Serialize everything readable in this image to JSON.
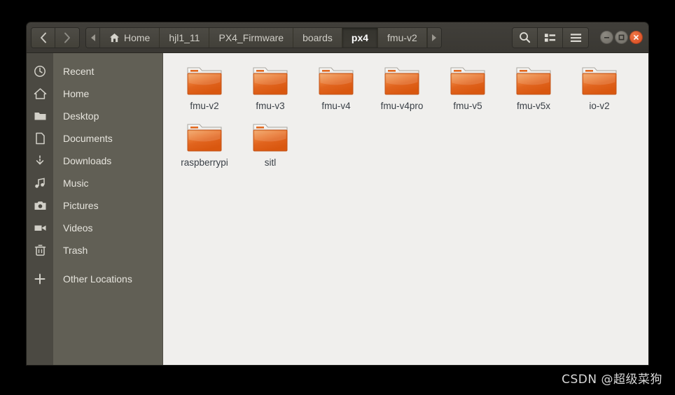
{
  "window": {
    "titlebar": {
      "back_label": "Back",
      "forward_label": "Forward",
      "path_scroll_left": "scroll-path-left",
      "path_scroll_right": "scroll-path-right",
      "breadcrumbs": [
        {
          "label": "Home",
          "icon": "home-icon",
          "active": false
        },
        {
          "label": "hjl1_11",
          "icon": "",
          "active": false
        },
        {
          "label": "PX4_Firmware",
          "icon": "",
          "active": false
        },
        {
          "label": "boards",
          "icon": "",
          "active": false
        },
        {
          "label": "px4",
          "icon": "",
          "active": true
        },
        {
          "label": "fmu-v2",
          "icon": "",
          "active": false
        }
      ],
      "tools": [
        {
          "name": "search-icon",
          "label": "Search"
        },
        {
          "name": "view-list-icon",
          "label": "View options"
        },
        {
          "name": "hamburger-menu-icon",
          "label": "Menu"
        }
      ],
      "window_controls": [
        {
          "name": "minimize-button",
          "label": "Minimize"
        },
        {
          "name": "maximize-button",
          "label": "Maximize"
        },
        {
          "name": "close-button",
          "label": "Close"
        }
      ]
    },
    "sidebar": {
      "items": [
        {
          "label": "Recent",
          "icon": "clock-icon"
        },
        {
          "label": "Home",
          "icon": "home-icon"
        },
        {
          "label": "Desktop",
          "icon": "folder-icon"
        },
        {
          "label": "Documents",
          "icon": "document-icon"
        },
        {
          "label": "Downloads",
          "icon": "download-icon"
        },
        {
          "label": "Music",
          "icon": "music-note-icon"
        },
        {
          "label": "Pictures",
          "icon": "camera-icon"
        },
        {
          "label": "Videos",
          "icon": "video-camera-icon"
        },
        {
          "label": "Trash",
          "icon": "trash-icon"
        },
        {
          "label": "Other Locations",
          "icon": "plus-icon"
        }
      ]
    },
    "content": {
      "files": [
        {
          "name": "fmu-v2",
          "type": "folder"
        },
        {
          "name": "fmu-v3",
          "type": "folder"
        },
        {
          "name": "fmu-v4",
          "type": "folder"
        },
        {
          "name": "fmu-v4pro",
          "type": "folder"
        },
        {
          "name": "fmu-v5",
          "type": "folder"
        },
        {
          "name": "fmu-v5x",
          "type": "folder"
        },
        {
          "name": "io-v2",
          "type": "folder"
        },
        {
          "name": "raspberrypi",
          "type": "folder"
        },
        {
          "name": "sitl",
          "type": "folder"
        }
      ]
    }
  },
  "watermark": {
    "text": "CSDN @超级菜狗"
  },
  "colors": {
    "titlebar": "#3d3b36",
    "icon_rail": "#4b4942",
    "sidebar": "#615f55",
    "content_bg": "#f0efed",
    "folder_orange": "#e8601c",
    "close_button": "#dd4814",
    "label_text": "#3a4047"
  }
}
